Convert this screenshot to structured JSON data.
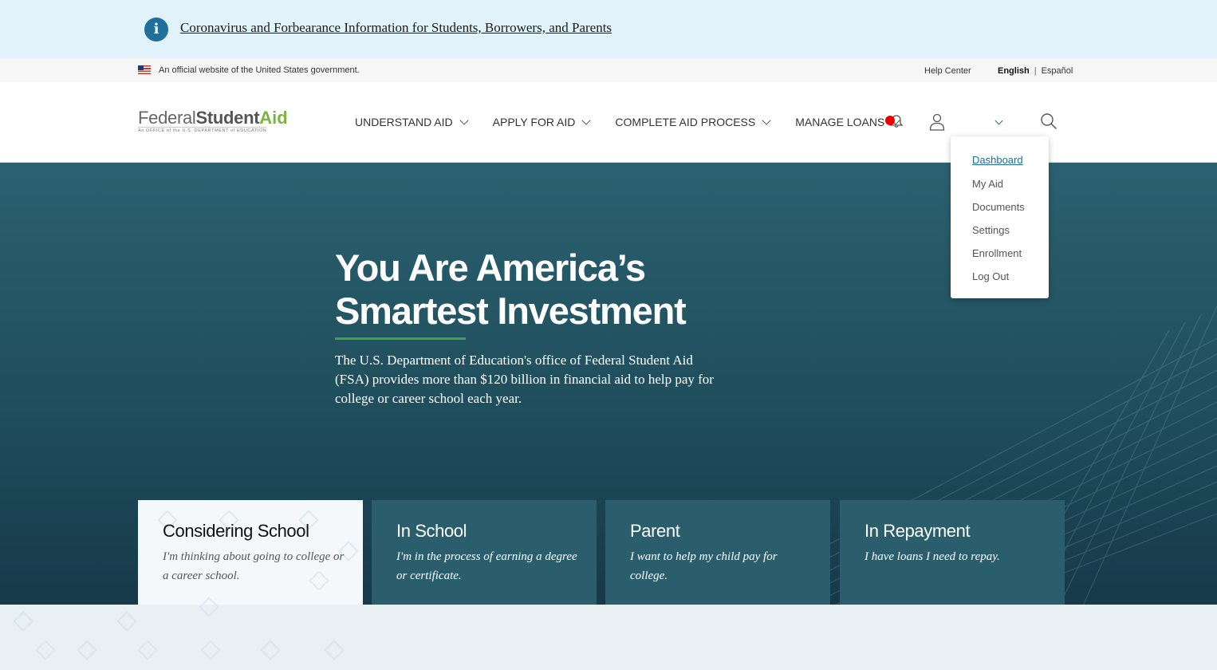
{
  "alert": {
    "link": "Coronavirus and Forbearance Information for Students, Borrowers, and Parents",
    "icon": "info-icon"
  },
  "govbar": {
    "official_text": "An official website of the United States government.",
    "help_center": "Help Center",
    "lang_en": "English",
    "lang_sep": "|",
    "lang_es": "Español"
  },
  "logo": {
    "federal": "Federal",
    "student": "Student",
    "aid": "Aid",
    "subtitle": "An OFFICE of the U.S. DEPARTMENT of EDUCATION"
  },
  "nav": {
    "items": [
      {
        "label": "UNDERSTAND AID"
      },
      {
        "label": "APPLY FOR AID"
      },
      {
        "label": "COMPLETE AID PROCESS"
      },
      {
        "label": "MANAGE LOANS"
      }
    ]
  },
  "account_menu": {
    "items": [
      {
        "label": "Dashboard"
      },
      {
        "label": "My Aid"
      },
      {
        "label": "Documents"
      },
      {
        "label": "Settings"
      },
      {
        "label": "Enrollment"
      },
      {
        "label": "Log Out"
      }
    ]
  },
  "hero": {
    "title_line1": "You Are America’s",
    "title_line2": "Smartest Investment",
    "body": "The U.S. Department of Education's office of Federal Student Aid (FSA) provides more than $120 billion in financial aid to help pay for college or career school each year."
  },
  "cards": [
    {
      "title": "Considering School",
      "desc": "I'm thinking about going to college or a career school."
    },
    {
      "title": "In School",
      "desc": "I'm in the process of earning a degree or certificate."
    },
    {
      "title": "Parent",
      "desc": "I want to help my child pay for college."
    },
    {
      "title": "In Repayment",
      "desc": "I have loans I need to repay."
    }
  ],
  "colors": {
    "accent": "#1f6f9a",
    "brand_green": "#7cb342",
    "hero_bg": "#1f4e5c",
    "notification": "#e00000"
  }
}
